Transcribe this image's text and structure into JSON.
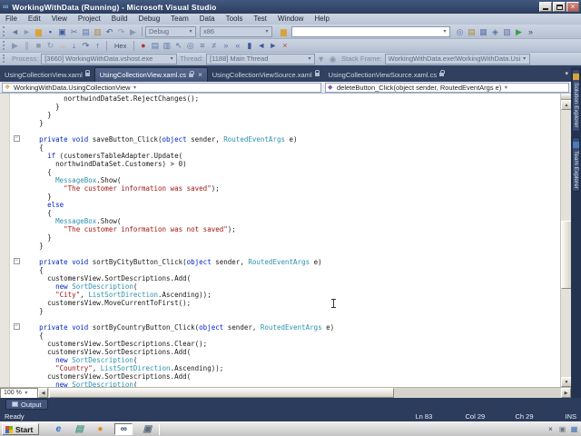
{
  "window": {
    "title": "WorkingWithData (Running) - Microsoft Visual Studio",
    "app_icon": "∞"
  },
  "menu": {
    "items": [
      "File",
      "Edit",
      "View",
      "Project",
      "Build",
      "Debug",
      "Team",
      "Data",
      "Tools",
      "Test",
      "Window",
      "Help"
    ]
  },
  "toolbar": {
    "config_combo": "Debug",
    "platform_combo": "x86",
    "search_value": "",
    "hex_label": "Hex",
    "row1_left": [
      {
        "name": "navigate-backward-icon",
        "glyph": "◄",
        "color": "#5d76a8"
      },
      {
        "name": "navigate-forward-icon",
        "glyph": "►",
        "color": "#8a98ad"
      },
      {
        "name": "open-file-icon",
        "glyph": "▆",
        "color": "#d9a33c"
      },
      {
        "name": "save-icon",
        "glyph": "▪",
        "color": "#3d5a99"
      },
      {
        "name": "save-all-icon",
        "glyph": "▣",
        "color": "#3d5a99"
      },
      {
        "name": "cut-icon",
        "glyph": "✂",
        "color": "#5d76a8"
      },
      {
        "name": "copy-icon",
        "glyph": "▤",
        "color": "#5d76a8"
      },
      {
        "name": "paste-icon",
        "glyph": "▥",
        "color": "#b08a3e"
      },
      {
        "name": "undo-icon",
        "glyph": "↶",
        "color": "#3d5a99"
      },
      {
        "name": "redo-icon",
        "glyph": "↷",
        "color": "#8a98ad"
      },
      {
        "name": "start-debugging-icon",
        "glyph": "▶",
        "color": "#8a98ad"
      }
    ],
    "row1_folder": {
      "name": "add-item-icon",
      "glyph": "▆",
      "color": "#d9a33c"
    },
    "row1_right": [
      {
        "name": "find-in-files-icon",
        "glyph": "◎",
        "color": "#5d76a8"
      },
      {
        "name": "solution-explorer-icon",
        "glyph": "▤",
        "color": "#b08a3e"
      },
      {
        "name": "properties-window-icon",
        "glyph": "▦",
        "color": "#5d76a8"
      },
      {
        "name": "object-browser-icon",
        "glyph": "◈",
        "color": "#5d76a8"
      },
      {
        "name": "toolbox-icon",
        "glyph": "▨",
        "color": "#5d76a8"
      },
      {
        "name": "extension-manager-icon",
        "glyph": "▶",
        "color": "#3f9c4f"
      },
      {
        "name": "toolbar-options-icon",
        "glyph": "»",
        "color": "#3c4c66"
      }
    ],
    "row2_a": [
      {
        "name": "continue-icon",
        "glyph": "▶",
        "color": "#8a98ad"
      },
      {
        "name": "break-all-icon",
        "glyph": "∥",
        "color": "#8a98ad"
      },
      {
        "name": "stop-debugging-icon",
        "glyph": "■",
        "color": "#8a98ad"
      },
      {
        "name": "restart-icon",
        "glyph": "↻",
        "color": "#8a98ad"
      },
      {
        "name": "show-next-statement-icon",
        "glyph": "→",
        "color": "#d9a33c"
      },
      {
        "name": "step-into-icon",
        "glyph": "↓",
        "color": "#3d5a99"
      },
      {
        "name": "step-over-icon",
        "glyph": "↷",
        "color": "#3d5a99"
      },
      {
        "name": "step-out-icon",
        "glyph": "↑",
        "color": "#3d5a99"
      }
    ],
    "row2_b": [
      {
        "name": "breakpoints-window-icon",
        "glyph": "●",
        "color": "#a33c3c"
      },
      {
        "name": "output-window-icon",
        "glyph": "▤",
        "color": "#5d76a8"
      },
      {
        "name": "immediate-window-icon",
        "glyph": "▥",
        "color": "#5d76a8"
      },
      {
        "name": "pointer-icon",
        "glyph": "↖",
        "color": "#5d76a8"
      },
      {
        "name": "find-symbol-icon",
        "glyph": "◎",
        "color": "#5d76a8"
      },
      {
        "name": "comment-icon",
        "glyph": "≡",
        "color": "#5d76a8"
      },
      {
        "name": "uncomment-icon",
        "glyph": "≠",
        "color": "#5d76a8"
      },
      {
        "name": "indent-icon",
        "glyph": "»",
        "color": "#5d76a8"
      },
      {
        "name": "outdent-icon",
        "glyph": "«",
        "color": "#5d76a8"
      },
      {
        "name": "toggle-bookmark-icon",
        "glyph": "▮",
        "color": "#3d5a99"
      },
      {
        "name": "prev-bookmark-icon",
        "glyph": "◄",
        "color": "#3d5a99"
      },
      {
        "name": "next-bookmark-icon",
        "glyph": "►",
        "color": "#3d5a99"
      },
      {
        "name": "clear-bookmarks-icon",
        "glyph": "×",
        "color": "#c04545"
      }
    ]
  },
  "debug_location": {
    "process_label": "Process:",
    "process_value": "[3660] WorkingWithData.vshost.exe",
    "thread_label": "Thread:",
    "thread_value": "[1188] Main Thread",
    "filter_icon": {
      "name": "thread-filter-icon",
      "glyph": "▼",
      "color": "#8a98ad"
    },
    "flag_icon": {
      "name": "flag-threads-icon",
      "glyph": "◉",
      "color": "#8a98ad"
    },
    "stack_frame_label": "Stack Frame:",
    "stack_frame_value": "WorkingWithData.exe!WorkingWithData.Usin"
  },
  "tabs": [
    {
      "label": "UsingCollectionView.xaml",
      "active": false,
      "locked": true
    },
    {
      "label": "UsingCollectionView.xaml.cs",
      "active": true,
      "locked": true
    },
    {
      "label": "UsingCollectionViewSource.xaml",
      "active": false,
      "locked": true
    },
    {
      "label": "UsingCollectionViewSource.xaml.cs",
      "active": false,
      "locked": true
    }
  ],
  "navigation": {
    "type_combo": "WorkingWithData.UsingCollectionView",
    "member_combo": "deleteButton_Click(object sender, RoutedEventArgs e)"
  },
  "editor": {
    "zoom": "100 %",
    "colors": {
      "keyword": "#0026c9",
      "type": "#2b91af",
      "string": "#a31515",
      "plain": "#1a1a1a"
    },
    "lines": [
      {
        "indent": 10,
        "box": false,
        "seg": [
          [
            "pl",
            "northwindDataSet.RejectChanges();"
          ]
        ]
      },
      {
        "indent": 8,
        "box": false,
        "seg": [
          [
            "pl",
            "}"
          ]
        ]
      },
      {
        "indent": 6,
        "box": false,
        "seg": [
          [
            "pl",
            "}"
          ]
        ]
      },
      {
        "indent": 4,
        "box": false,
        "seg": [
          [
            "pl",
            "}"
          ]
        ]
      },
      {
        "indent": 0,
        "box": false,
        "seg": []
      },
      {
        "indent": 4,
        "box": true,
        "seg": [
          [
            "kw",
            "private"
          ],
          [
            "pl",
            " "
          ],
          [
            "kw",
            "void"
          ],
          [
            "pl",
            " saveButton_Click("
          ],
          [
            "kw",
            "object"
          ],
          [
            "pl",
            " sender, "
          ],
          [
            "ty",
            "RoutedEventArgs"
          ],
          [
            "pl",
            " e)"
          ]
        ]
      },
      {
        "indent": 4,
        "box": false,
        "seg": [
          [
            "pl",
            "{"
          ]
        ]
      },
      {
        "indent": 6,
        "box": false,
        "seg": [
          [
            "kw",
            "if"
          ],
          [
            "pl",
            " (customersTableAdapter.Update("
          ]
        ]
      },
      {
        "indent": 8,
        "box": false,
        "seg": [
          [
            "pl",
            "northwindDataSet.Customers) > 0)"
          ]
        ]
      },
      {
        "indent": 6,
        "box": false,
        "seg": [
          [
            "pl",
            "{"
          ]
        ]
      },
      {
        "indent": 8,
        "box": false,
        "seg": [
          [
            "ty",
            "MessageBox"
          ],
          [
            "pl",
            ".Show("
          ]
        ]
      },
      {
        "indent": 10,
        "box": false,
        "seg": [
          [
            "st",
            "\"The customer information was saved\""
          ],
          [
            "pl",
            ");"
          ]
        ]
      },
      {
        "indent": 6,
        "box": false,
        "seg": [
          [
            "pl",
            "}"
          ]
        ]
      },
      {
        "indent": 6,
        "box": false,
        "seg": [
          [
            "kw",
            "else"
          ]
        ]
      },
      {
        "indent": 6,
        "box": false,
        "seg": [
          [
            "pl",
            "{"
          ]
        ]
      },
      {
        "indent": 8,
        "box": false,
        "seg": [
          [
            "ty",
            "MessageBox"
          ],
          [
            "pl",
            ".Show("
          ]
        ]
      },
      {
        "indent": 10,
        "box": false,
        "seg": [
          [
            "st",
            "\"The customer information was not saved\""
          ],
          [
            "pl",
            ");"
          ]
        ]
      },
      {
        "indent": 6,
        "box": false,
        "seg": [
          [
            "pl",
            "}"
          ]
        ]
      },
      {
        "indent": 4,
        "box": false,
        "seg": [
          [
            "pl",
            "}"
          ]
        ]
      },
      {
        "indent": 0,
        "box": false,
        "seg": []
      },
      {
        "indent": 4,
        "box": true,
        "seg": [
          [
            "kw",
            "private"
          ],
          [
            "pl",
            " "
          ],
          [
            "kw",
            "void"
          ],
          [
            "pl",
            " sortByCityButton_Click("
          ],
          [
            "kw",
            "object"
          ],
          [
            "pl",
            " sender, "
          ],
          [
            "ty",
            "RoutedEventArgs"
          ],
          [
            "pl",
            " e)"
          ]
        ]
      },
      {
        "indent": 4,
        "box": false,
        "seg": [
          [
            "pl",
            "{"
          ]
        ]
      },
      {
        "indent": 6,
        "box": false,
        "seg": [
          [
            "pl",
            "customersView.SortDescriptions.Add("
          ]
        ]
      },
      {
        "indent": 8,
        "box": false,
        "seg": [
          [
            "kw",
            "new"
          ],
          [
            "pl",
            " "
          ],
          [
            "ty",
            "SortDescription"
          ],
          [
            "pl",
            "("
          ]
        ]
      },
      {
        "indent": 8,
        "box": false,
        "seg": [
          [
            "st",
            "\"City\""
          ],
          [
            "pl",
            ", "
          ],
          [
            "ty",
            "ListSortDirection"
          ],
          [
            "pl",
            ".Ascending));"
          ]
        ]
      },
      {
        "indent": 6,
        "box": false,
        "seg": [
          [
            "pl",
            "customersView.MoveCurrentToFirst();"
          ]
        ]
      },
      {
        "indent": 4,
        "box": false,
        "seg": [
          [
            "pl",
            "}"
          ]
        ]
      },
      {
        "indent": 0,
        "box": false,
        "seg": []
      },
      {
        "indent": 4,
        "box": true,
        "seg": [
          [
            "kw",
            "private"
          ],
          [
            "pl",
            " "
          ],
          [
            "kw",
            "void"
          ],
          [
            "pl",
            " sortByCountryButton_Click("
          ],
          [
            "kw",
            "object"
          ],
          [
            "pl",
            " sender, "
          ],
          [
            "ty",
            "RoutedEventArgs"
          ],
          [
            "pl",
            " e)"
          ]
        ]
      },
      {
        "indent": 4,
        "box": false,
        "seg": [
          [
            "pl",
            "{"
          ]
        ]
      },
      {
        "indent": 6,
        "box": false,
        "seg": [
          [
            "pl",
            "customersView.SortDescriptions.Clear();"
          ]
        ]
      },
      {
        "indent": 6,
        "box": false,
        "seg": [
          [
            "pl",
            "customersView.SortDescriptions.Add("
          ]
        ]
      },
      {
        "indent": 8,
        "box": false,
        "seg": [
          [
            "kw",
            "new"
          ],
          [
            "pl",
            " "
          ],
          [
            "ty",
            "SortDescription"
          ],
          [
            "pl",
            "("
          ]
        ]
      },
      {
        "indent": 8,
        "box": false,
        "seg": [
          [
            "st",
            "\"Country\""
          ],
          [
            "pl",
            ", "
          ],
          [
            "ty",
            "ListSortDirection"
          ],
          [
            "pl",
            ".Ascending));"
          ]
        ]
      },
      {
        "indent": 6,
        "box": false,
        "seg": [
          [
            "pl",
            "customersView.SortDescriptions.Add("
          ]
        ]
      },
      {
        "indent": 8,
        "box": false,
        "seg": [
          [
            "kw",
            "new"
          ],
          [
            "pl",
            " "
          ],
          [
            "ty",
            "SortDescription"
          ],
          [
            "pl",
            "("
          ]
        ]
      }
    ]
  },
  "side_tabs": [
    {
      "label": "Solution Explorer",
      "icon_color": "#d9a33c",
      "icon_name": "solution-explorer-icon"
    },
    {
      "label": "Team Explorer",
      "icon_color": "#4f79c0",
      "icon_name": "team-explorer-icon"
    }
  ],
  "output_panel": {
    "tab": "Output"
  },
  "status_bar": {
    "message": "Ready",
    "line": "Ln 83",
    "col": "Col 29",
    "ch": "Ch 29",
    "mode": "INS"
  },
  "taskbar": {
    "start_label": "Start",
    "quick_launch": [
      {
        "name": "internet-explorer-icon",
        "glyph": "e",
        "color": "#2f6fd6",
        "pressed": false
      },
      {
        "name": "show-desktop-icon",
        "glyph": "▤",
        "color": "#4f9c8a",
        "pressed": false
      },
      {
        "name": "media-player-icon",
        "glyph": "●",
        "color": "#e8861a",
        "pressed": false
      },
      {
        "name": "visual-studio-icon",
        "glyph": "∞",
        "color": "#1f3a6e",
        "pressed": true
      },
      {
        "name": "app-window-icon",
        "glyph": "▣",
        "color": "#5a6b7a",
        "pressed": false
      }
    ],
    "tray_icons": [
      {
        "name": "tray-status-icon",
        "glyph": "×",
        "color": "#444"
      },
      {
        "name": "tray-display-icon",
        "glyph": "▣",
        "color": "#6d7a8a"
      },
      {
        "name": "tray-network-icon",
        "glyph": "▦",
        "color": "#3f6fb5"
      }
    ]
  }
}
